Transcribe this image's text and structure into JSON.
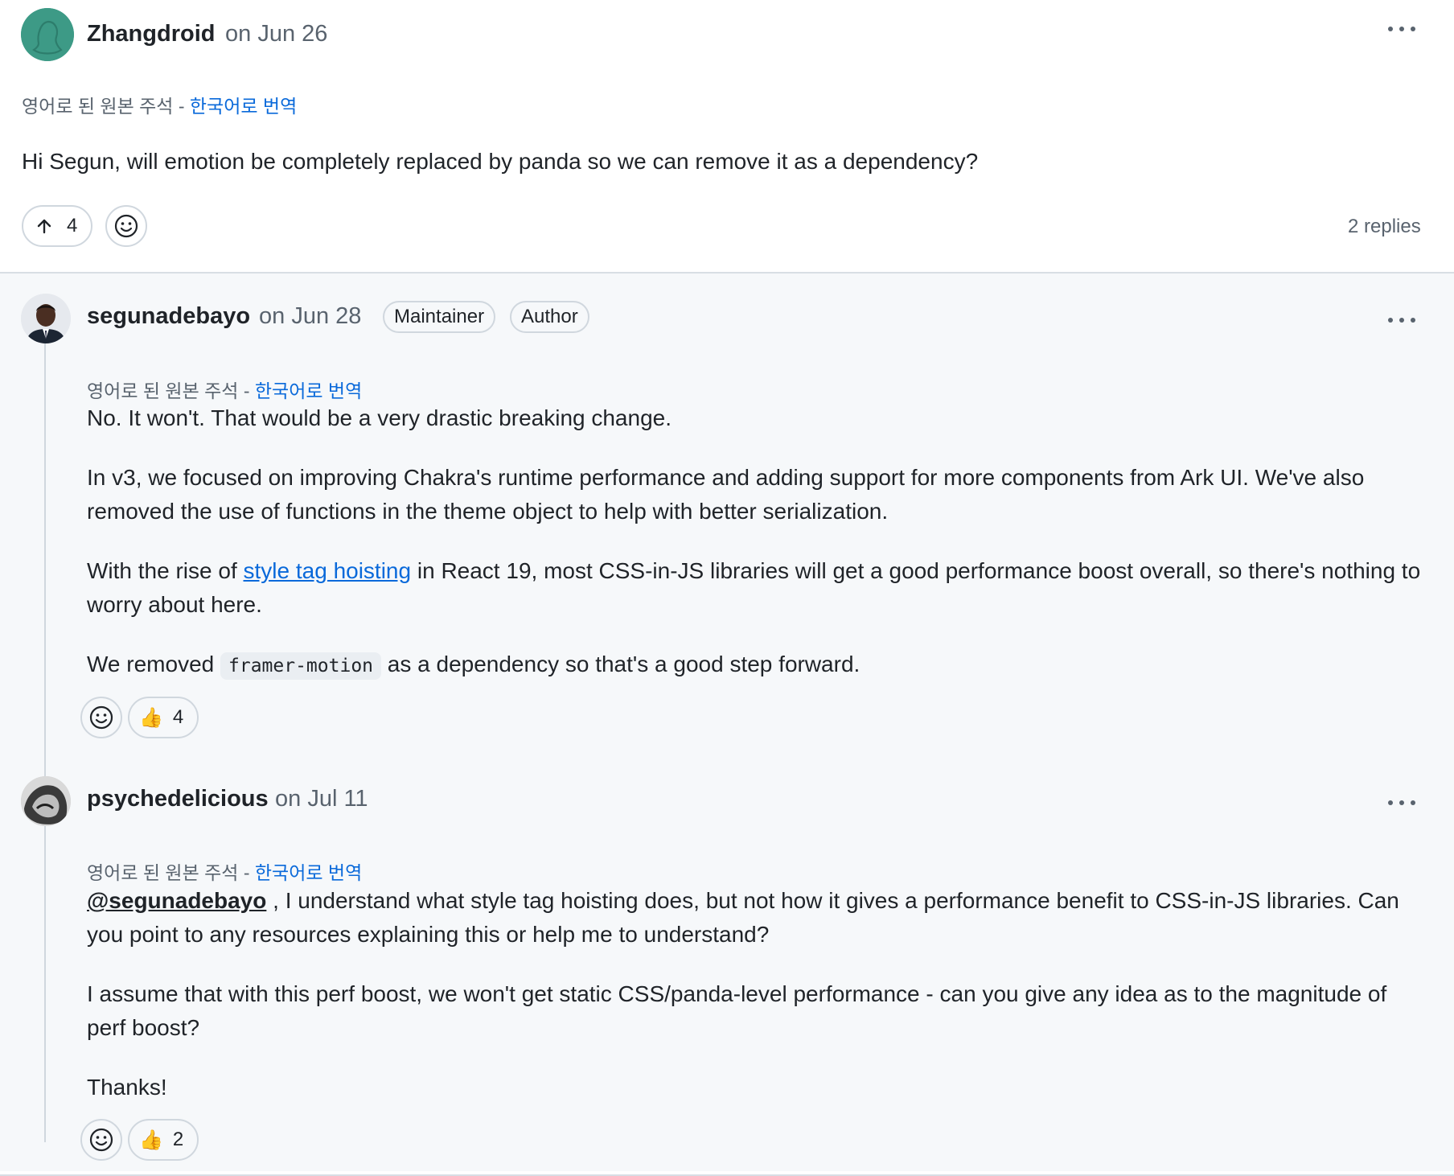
{
  "translation": {
    "prefix": "영어로 된 원본 주석 - ",
    "link": "한국어로 번역"
  },
  "top_comment": {
    "author": "Zhangdroid",
    "date": "on Jun 26",
    "body": "Hi Segun, will emotion be completely replaced by panda so we can remove it as a dependency?",
    "upvote_count": "4",
    "replies_label": "2 replies"
  },
  "reply1": {
    "author": "segunadebayo",
    "date": "on Jun 28",
    "badges": [
      "Maintainer",
      "Author"
    ],
    "p1": "No. It won't. That would be a very drastic breaking change.",
    "p2": "In v3, we focused on improving Chakra's runtime performance and adding support for more components from Ark UI. We've also removed the use of functions in the theme object to help with better serialization.",
    "p3_before": "With the rise of ",
    "p3_link": "style tag hoisting",
    "p3_after": " in React 19, most CSS-in-JS libraries will get a good performance boost overall, so there's nothing to worry about here.",
    "p4_before": "We removed ",
    "p4_code": "framer-motion",
    "p4_after": " as a dependency so that's a good step forward.",
    "thumbs_count": "4"
  },
  "reply2": {
    "author": "psychedelicious",
    "date": "on Jul 11",
    "mention": "@segunadebayo",
    "p1_after": " , I understand what style tag hoisting does, but not how it gives a performance benefit to CSS-in-JS libraries. Can you point to any resources explaining this or help me to understand?",
    "p2": "I assume that with this perf boost, we won't get static CSS/panda-level performance - can you give any idea as to the magnitude of perf boost?",
    "p3": "Thanks!",
    "thumbs_count": "2"
  },
  "icons": {
    "upvote": "arrow-up-icon",
    "emoji": "smiley-icon",
    "reaction": "thumbs-up-emoji",
    "menu": "kebab-horizontal-icon"
  },
  "colors": {
    "link": "#0969da",
    "muted": "#59636e",
    "border": "#d0d7de",
    "thread_bg": "#f6f8fa",
    "avatar_teal": "#3d9a86"
  }
}
